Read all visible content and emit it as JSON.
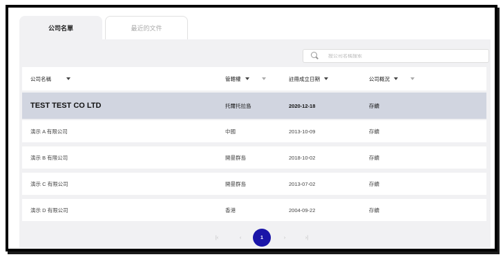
{
  "tabs": [
    {
      "label": "公司名單",
      "active": true
    },
    {
      "label": "最近的文件",
      "active": false
    }
  ],
  "search": {
    "placeholder": "按公司名稱搜索"
  },
  "table": {
    "columns": [
      "公司名稱",
      "管轄權",
      "註冊成立日期",
      "公司概況"
    ],
    "rows": [
      {
        "name": "TEST TEST CO LTD",
        "jurisdiction": "托爾托拉島",
        "date": "2020-12-18",
        "status": "存續"
      },
      {
        "name": "演示 A 有限公司",
        "jurisdiction": "中國",
        "date": "2013-10-09",
        "status": "存續"
      },
      {
        "name": "演示 B 有限公司",
        "jurisdiction": "開曼群島",
        "date": "2018-10-02",
        "status": "存續"
      },
      {
        "name": "演示 C 有限公司",
        "jurisdiction": "開曼群島",
        "date": "2013-07-02",
        "status": "存續"
      },
      {
        "name": "演示 D 有限公司",
        "jurisdiction": "香港",
        "date": "2004-09-22",
        "status": "存續"
      }
    ]
  },
  "pagination": {
    "first": "|‹",
    "prev": "‹",
    "current": "1",
    "next": "›",
    "last": "›|"
  },
  "colors": {
    "accent": "#1a15a8",
    "highlight_row": "#d1d5e0",
    "panel_bg": "#f1f1f3"
  }
}
